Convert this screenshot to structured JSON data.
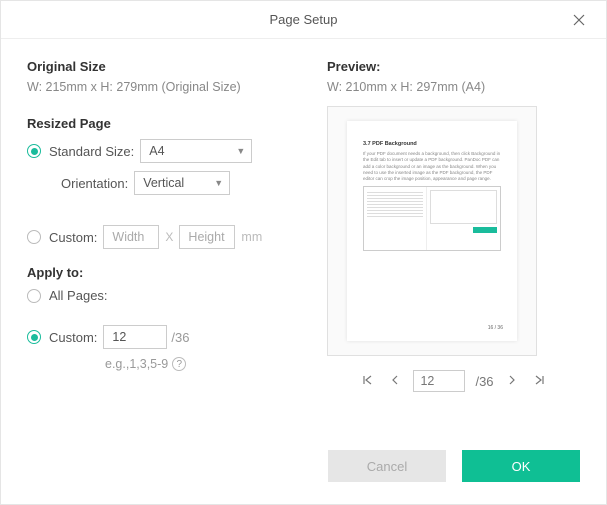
{
  "title": "Page Setup",
  "original_size": {
    "heading": "Original Size",
    "text": "W: 215mm x H: 279mm (Original Size)"
  },
  "resized": {
    "heading": "Resized Page",
    "standard_label": "Standard Size:",
    "standard_value": "A4",
    "orientation_label": "Orientation:",
    "orientation_value": "Vertical",
    "custom_label": "Custom:",
    "width_placeholder": "Width",
    "height_placeholder": "Height",
    "unit": "mm"
  },
  "apply": {
    "heading": "Apply to:",
    "all_label": "All Pages:",
    "custom_label": "Custom:",
    "custom_value": "12",
    "total": "/36",
    "example": "e.g.,1,3,5-9"
  },
  "preview": {
    "heading": "Preview:",
    "text": "W: 210mm x H: 297mm (A4)",
    "doc_heading": "3.7 PDF Background",
    "para": "If your PDF document needs a background, then click Background in the Edit tab to insert or update a PDF background. PanDoc PDF can add a color background or an image as the background. When you need to use the inserted image as the PDF background, the PDF editor can crop the image position, appearance and page range.",
    "pg_num": "16 / 36"
  },
  "pager": {
    "value": "12",
    "total": "/36"
  },
  "buttons": {
    "cancel": "Cancel",
    "ok": "OK"
  }
}
